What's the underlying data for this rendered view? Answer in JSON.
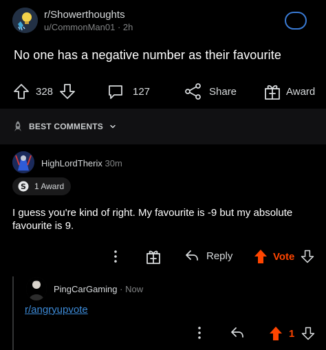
{
  "post": {
    "subreddit": "r/Showerthoughts",
    "author": "u/CommonMan01",
    "age": "2h",
    "title": "No one has a negative number as their favourite",
    "upvotes": "328",
    "comments": "127",
    "share_label": "Share",
    "award_label": "Award"
  },
  "sort": {
    "label": "BEST COMMENTS"
  },
  "comment": {
    "author": "HighLordTherix",
    "age": "30m",
    "award_pill": "1 Award",
    "body": "I guess you're kind of right. My favourite is -9 but my absolute favourite is 9.",
    "reply_label": "Reply",
    "vote_label": "Vote"
  },
  "reply": {
    "author": "PingCarGaming",
    "age": "Now",
    "link": "r/angryupvote",
    "score": "1"
  },
  "colors": {
    "accent_orange": "#ff4500",
    "link_blue": "#3d8bd8",
    "join_ring": "#3a7bd5"
  }
}
